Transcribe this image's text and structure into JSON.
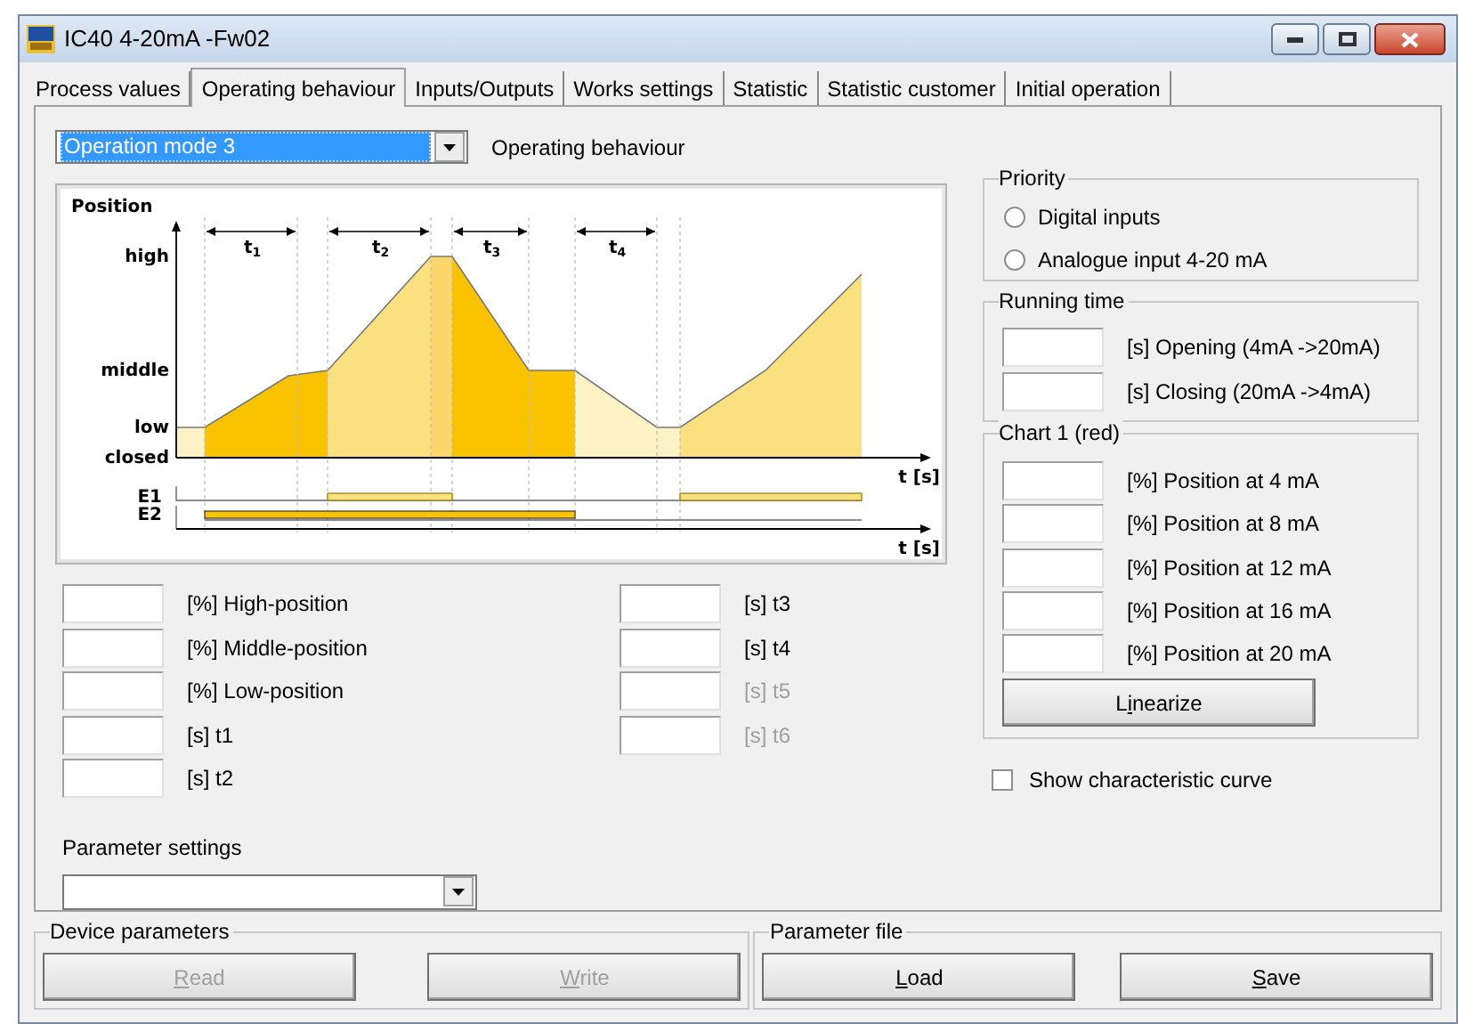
{
  "window": {
    "title": "IC40 4-20mA -Fw02"
  },
  "tabs": [
    {
      "label": "Process values",
      "selected": false
    },
    {
      "label": "Operating behaviour",
      "selected": true
    },
    {
      "label": "Inputs/Outputs",
      "selected": false
    },
    {
      "label": "Works settings",
      "selected": false
    },
    {
      "label": "Statistic",
      "selected": false
    },
    {
      "label": "Statistic customer",
      "selected": false
    },
    {
      "label": "Initial operation",
      "selected": false
    }
  ],
  "mode_select": {
    "value": "Operation mode 3",
    "label": "Operating behaviour"
  },
  "diagram": {
    "y_title": "Position",
    "levels": [
      "high",
      "middle",
      "low",
      "closed"
    ],
    "x_label": "t [s]",
    "signal_x_label": "t [s]",
    "signals": [
      "E1",
      "E2"
    ],
    "intervals": [
      {
        "base": "t",
        "sub": "1"
      },
      {
        "base": "t",
        "sub": "2"
      },
      {
        "base": "t",
        "sub": "3"
      },
      {
        "base": "t",
        "sub": "4"
      }
    ]
  },
  "parameters_left": [
    {
      "label": "[%] High-position",
      "disabled": false
    },
    {
      "label": "[%] Middle-position",
      "disabled": false
    },
    {
      "label": "[%] Low-position",
      "disabled": false
    },
    {
      "label": "[s] t1",
      "disabled": false
    },
    {
      "label": "[s] t2",
      "disabled": false
    }
  ],
  "parameters_right": [
    {
      "label": "[s] t3",
      "disabled": false
    },
    {
      "label": "[s] t4",
      "disabled": false
    },
    {
      "label": "[s] t5",
      "disabled": true
    },
    {
      "label": "[s] t6",
      "disabled": true
    }
  ],
  "parameter_settings": {
    "label": "Parameter settings"
  },
  "priority": {
    "title": "Priority",
    "options": [
      {
        "label": "Digital inputs",
        "selected": false
      },
      {
        "label": "Analogue input 4-20 mA",
        "selected": false
      }
    ]
  },
  "running_time": {
    "title": "Running time",
    "fields": [
      "[s] Opening (4mA ->20mA)",
      "[s] Closing (20mA ->4mA)"
    ]
  },
  "chart_1": {
    "title": "Chart 1 (red)",
    "fields": [
      "[%] Position at 4 mA",
      "[%] Position at 8 mA",
      "[%] Position at 12 mA",
      "[%] Position at 16 mA",
      "[%] Position at 20 mA"
    ],
    "button": {
      "label": {
        "lead": "L",
        "key": "i",
        "rest": "nearize"
      },
      "disabled": false
    }
  },
  "show_curve": {
    "label": "Show characteristic curve",
    "checked": false
  },
  "device_parameters": {
    "title": "Device parameters",
    "buttons": [
      {
        "label": {
          "key": "R",
          "rest": "ead"
        },
        "disabled": true
      },
      {
        "label": {
          "key": "W",
          "rest": "rite"
        },
        "disabled": true
      }
    ]
  },
  "parameter_file": {
    "title": "Parameter file",
    "buttons": [
      {
        "label": {
          "key": "L",
          "rest": "oad"
        },
        "disabled": false
      },
      {
        "label": {
          "key": "S",
          "rest": "ave"
        },
        "disabled": false
      }
    ]
  }
}
